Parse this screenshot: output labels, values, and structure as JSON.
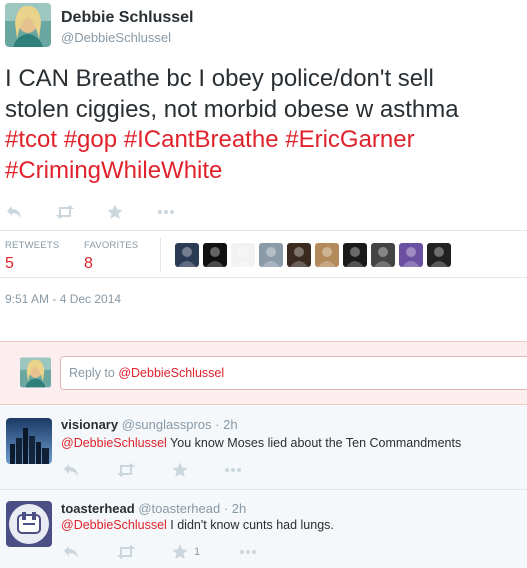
{
  "tweet": {
    "author_name": "Debbie Schlussel",
    "author_handle": "@DebbieSchlussel",
    "text_line_1": "I CAN Breathe bc I obey police/don't sell",
    "text_line_2": "stolen ciggies, not morbid obese w asthma",
    "hashtags_line_3": [
      "#tcot",
      "#gop",
      "#ICantBreathe",
      "#EricGarner"
    ],
    "hashtags_line_4": [
      "#CrimingWhileWhite"
    ],
    "actions": [
      {
        "name": "reply",
        "icon": "reply-icon"
      },
      {
        "name": "retweet",
        "icon": "retweet-icon"
      },
      {
        "name": "favorite",
        "icon": "star-icon"
      },
      {
        "name": "more",
        "icon": "more-icon"
      }
    ],
    "stats": {
      "retweets_label": "RETWEETS",
      "retweets_count": "5",
      "favorites_label": "FAVORITES",
      "favorites_count": "8"
    },
    "favoriter_avatar_colors": [
      "#2b3a55",
      "#111111",
      "#f2f2f2",
      "#8a9aa8",
      "#3a2a20",
      "#b38a5a",
      "#1a1a1a",
      "#444444",
      "#6b4fa0",
      "#222222"
    ],
    "timestamp": "9:51 AM - 4 Dec 2014"
  },
  "reply_box": {
    "prefix": "Reply to ",
    "mention": "@DebbieSchlussel"
  },
  "replies": [
    {
      "name": "visionary",
      "handle": "@sunglasspros",
      "time": "2h",
      "mention": "@DebbieSchlussel",
      "text": " You know Moses lied about the Ten Commandments",
      "favorite_count": ""
    },
    {
      "name": "toasterhead",
      "handle": "@toasterhead",
      "time": "2h",
      "mention": "@DebbieSchlussel",
      "text": " I didn't know cunts had lungs.",
      "favorite_count": "1"
    }
  ],
  "colors": {
    "hashtag": "#e0222b",
    "muted": "#8899a6",
    "reply_box_bg": "#fceeee"
  }
}
